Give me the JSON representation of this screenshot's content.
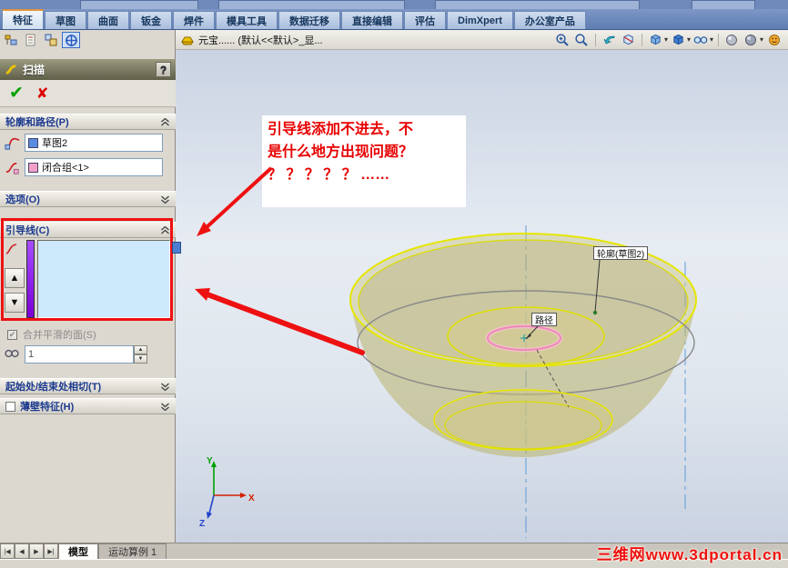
{
  "tabbar": {
    "tabs": [
      "特征",
      "草图",
      "曲面",
      "钣金",
      "焊件",
      "模具工具",
      "数据迁移",
      "直接编辑",
      "评估",
      "DimXpert",
      "办公室产品"
    ]
  },
  "pm": {
    "title": "扫描",
    "help_label": "?",
    "ok_glyph": "✔",
    "cancel_glyph": "✘",
    "sections": {
      "profile_path_label": "轮廓和路径(P)",
      "options_label": "选项(O)",
      "guide_label": "引导线(C)",
      "start_end_label": "起始处/结束处相切(T)",
      "thin_label": "薄壁特征(H)"
    },
    "profile_value": "草图2",
    "path_value": "闭合组<1>",
    "up_glyph": "▲",
    "down_glyph": "▼",
    "merge_check_glyph": "✔",
    "merge_label": "合并平滑的面(S)",
    "section_number": "1"
  },
  "viewport": {
    "doc_title": "元宝...... (默认<<默认>_显...",
    "annotation_lines": [
      "引导线添加不进去，不",
      "是什么地方出现问题？",
      "？ ？ ？ ？ ？ ……"
    ],
    "profile_callout": "轮廓(草图2)",
    "path_callout": "路径",
    "axis_x": "X",
    "axis_y": "Y",
    "axis_z": "Z",
    "watermark": "三维网www.3dportal.cn"
  },
  "bottom": {
    "nav": [
      "|◀",
      "◀",
      "▶",
      "▶|"
    ],
    "model_tab": "模型",
    "motion_tab": "运动算例 1"
  },
  "colors": {
    "annotation_red": "#ee1111",
    "guide_list_blue": "#cdeafc",
    "bowl_yellow": "#e8e800",
    "profile_pink": "#f49ac1"
  }
}
